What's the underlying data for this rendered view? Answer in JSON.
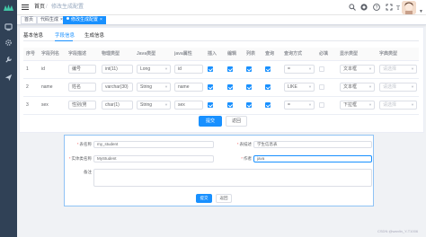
{
  "header": {
    "breadcrumb": {
      "home": "首页",
      "separator": "/",
      "current": "修改生成配置"
    }
  },
  "tags": [
    {
      "label": "首页"
    },
    {
      "label": "代码生成",
      "close": "×"
    },
    {
      "label": "修改生成配置",
      "close": "×"
    }
  ],
  "tabs": [
    "基本信息",
    "字段信息",
    "生成信息"
  ],
  "table": {
    "headers": [
      "序号",
      "字段列名",
      "字段描述",
      "物理类型",
      "Java类型",
      "java属性",
      "插入",
      "编辑",
      "列表",
      "查询",
      "查询方式",
      "必填",
      "显示类型",
      "字典类型"
    ],
    "rows": [
      {
        "index": "1",
        "column": "id",
        "desc": "编号",
        "physical": "int(11)",
        "java_type": "Long",
        "java_field": "id",
        "insert": true,
        "edit": true,
        "list": true,
        "query": true,
        "query_type": "=",
        "required": false,
        "html_type": "文本框",
        "dict": "请选择"
      },
      {
        "index": "2",
        "column": "name",
        "desc": "姓名",
        "physical": "varchar(30)",
        "java_type": "String",
        "java_field": "name",
        "insert": true,
        "edit": true,
        "list": true,
        "query": true,
        "query_type": "LIKE",
        "required": false,
        "html_type": "文本框",
        "dict": "请选择"
      },
      {
        "index": "3",
        "column": "sex",
        "desc": "性别(男",
        "physical": "char(1)",
        "java_type": "String",
        "java_field": "sex",
        "insert": true,
        "edit": true,
        "list": true,
        "query": true,
        "query_type": "=",
        "required": false,
        "html_type": "下拉框",
        "dict": "请选择"
      }
    ]
  },
  "buttons": {
    "submit": "提交",
    "back": "返回"
  },
  "form": {
    "table_name_label": "表名称",
    "table_name": "my_student",
    "table_desc_label": "表描述",
    "table_desc": "学生信息表",
    "entity_label": "实体类名称",
    "entity": "MyStudent",
    "author_label": "作者",
    "author": "java",
    "remark_label": "备注",
    "submit": "提交",
    "back": "返回"
  },
  "watermark": "CSDN @wanlin_Y-T1006",
  "colors": {
    "primary": "#1890ff",
    "sidebar": "#304156"
  }
}
